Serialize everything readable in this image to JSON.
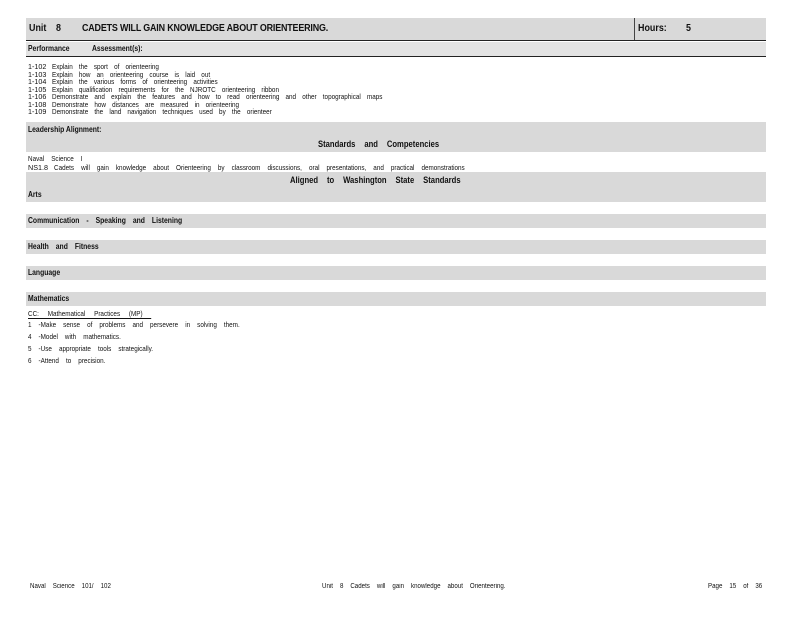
{
  "header": {
    "unit_label": "Unit",
    "unit_number": "8",
    "unit_title": "CADETS WILL GAIN KNOWLEDGE ABOUT ORIENTEERING.",
    "hours_label": "Hours:",
    "hours_value": "5"
  },
  "performance_bar": {
    "performance_label": "Performance",
    "assessment_label": "Assessment(s):"
  },
  "performance_items": [
    {
      "code": "1-102",
      "text": "Explain the sport of orienteering"
    },
    {
      "code": "1-103",
      "text": "Explain how an orienteering course is laid out"
    },
    {
      "code": "1-104",
      "text": "Explain the various forms of orienteering activities"
    },
    {
      "code": "1-105",
      "text": "Explain qualification requirements for the NJROTC orienteering ribbon"
    },
    {
      "code": "1-106",
      "text": "Demonstrate and explain the features and how to read orienteering and other topographical maps"
    },
    {
      "code": "1-108",
      "text": "Demonstrate how distances are measured in orienteering"
    },
    {
      "code": "1-109",
      "text": "Demonstrate the land navigation techniques used by the orienteer"
    }
  ],
  "leadership": {
    "label": "Leadership Alignment:",
    "standards_heading": "Standards and Competencies"
  },
  "naval_science": {
    "title": "Naval Science I",
    "code": "NS1.8",
    "text": "Cadets will gain knowledge about Orienteering by classroom discussions, oral presentations, and practical demonstrations"
  },
  "washington": {
    "heading": "Aligned to Washington State Standards",
    "arts_label": "Arts"
  },
  "categories": {
    "communication": "Communication - Speaking and Listening",
    "health": "Health and Fitness",
    "language": "Language",
    "mathematics": "Mathematics"
  },
  "mathematics": {
    "cc_heading": "CC: Mathematical Practices (MP)",
    "items": [
      "1 -Make sense of problems and persevere in solving them.",
      "4 -Model with mathematics.",
      "5 -Use appropriate tools strategically.",
      "6 -Attend to precision."
    ]
  },
  "footer": {
    "left": "Naval Science 101/ 102",
    "center": "Unit 8 Cadets will gain knowledge about Orienteering.",
    "right": "Page 15 of 36"
  }
}
